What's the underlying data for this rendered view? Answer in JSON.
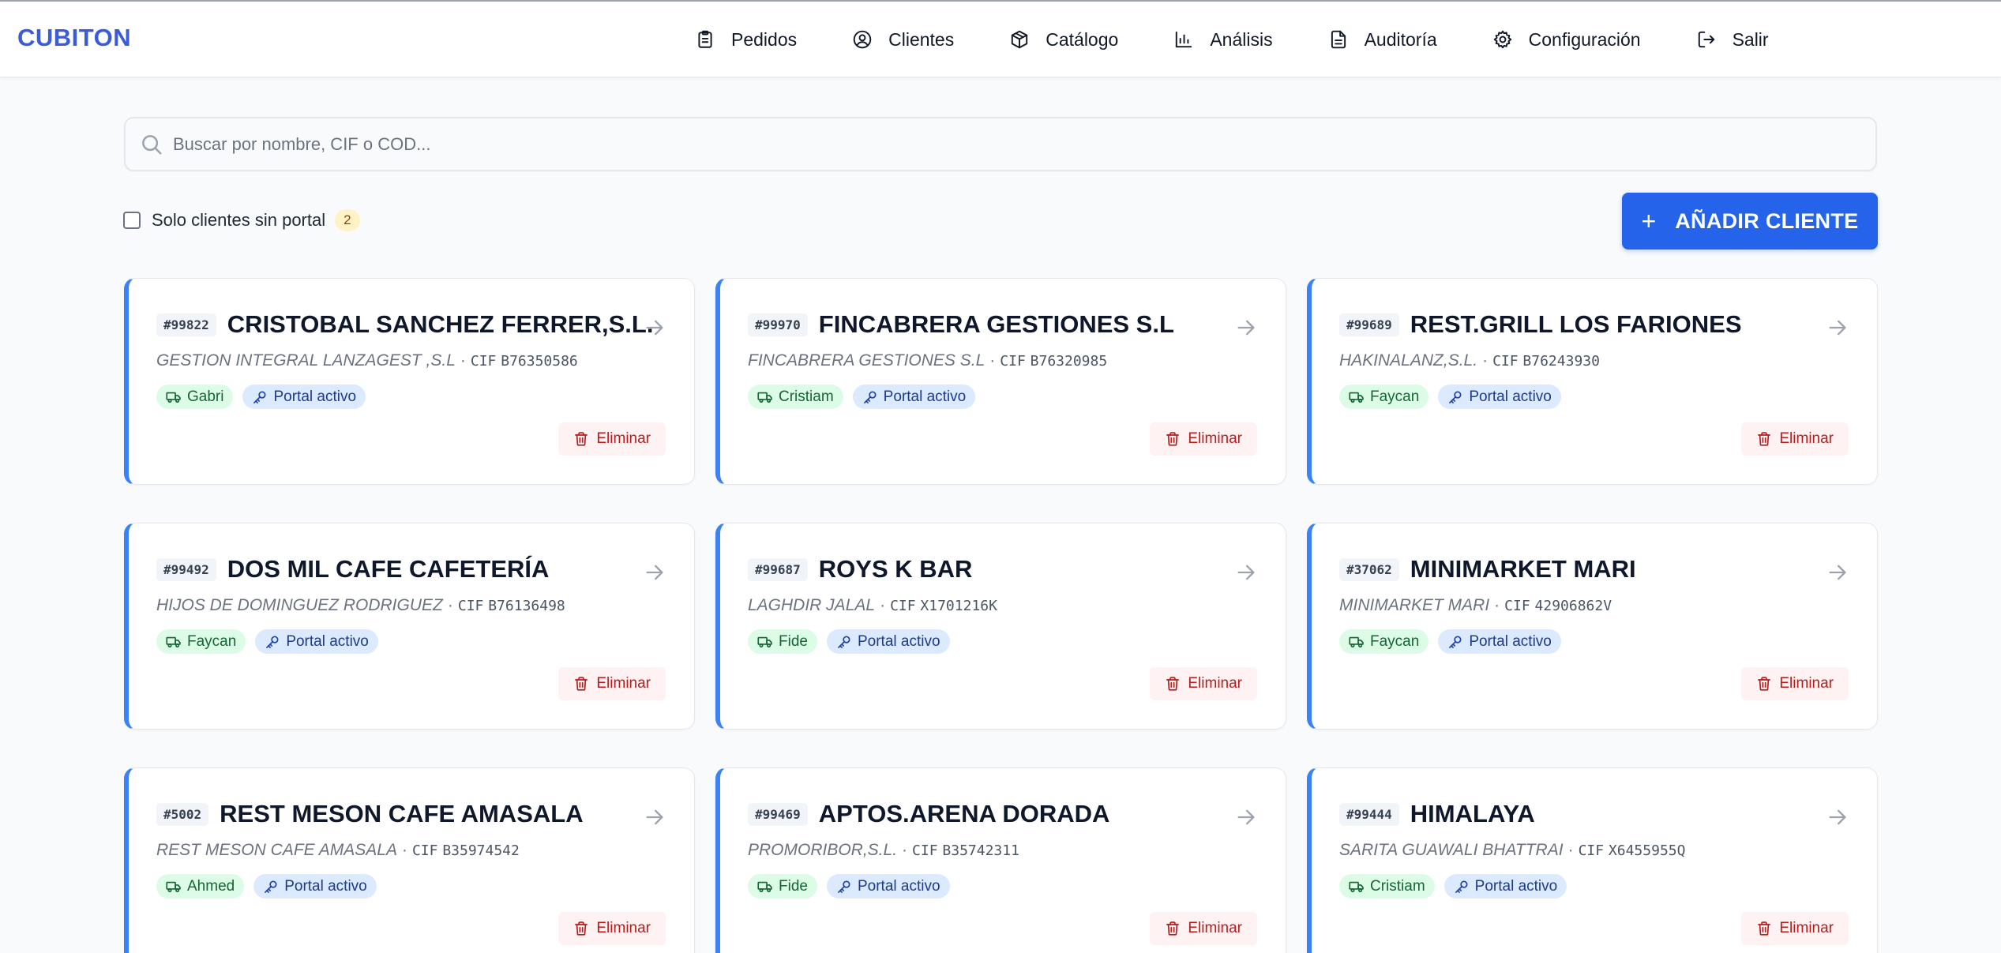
{
  "app": {
    "logo": "CUBITON"
  },
  "nav": [
    {
      "label": "Pedidos",
      "icon": "clipboard-icon"
    },
    {
      "label": "Clientes",
      "icon": "user-circle-icon"
    },
    {
      "label": "Catálogo",
      "icon": "box-icon"
    },
    {
      "label": "Análisis",
      "icon": "bar-chart-icon"
    },
    {
      "label": "Auditoría",
      "icon": "document-icon"
    },
    {
      "label": "Configuración",
      "icon": "gear-icon"
    },
    {
      "label": "Salir",
      "icon": "logout-icon"
    }
  ],
  "search": {
    "placeholder": "Buscar por nombre, CIF o COD...",
    "value": ""
  },
  "filter": {
    "label": "Solo clientes sin portal",
    "count": "2",
    "checked": false
  },
  "add_button": {
    "icon": "+",
    "label": "AÑADIR CLIENTE"
  },
  "colors": {
    "accent": "#2563eb",
    "brand": "#3b5bdb",
    "card_border": "#3b82f6",
    "delete": "#b91c1c"
  },
  "clients": [
    {
      "code": "#99822",
      "name": "CRISTOBAL SANCHEZ FERRER,S.L.",
      "company": "GESTION INTEGRAL LANZAGEST ,S.L",
      "cif_label": "CIF",
      "cif": "B76350586",
      "driver": "Gabri",
      "portal": "Portal activo",
      "delete_label": "Eliminar"
    },
    {
      "code": "#99970",
      "name": "FINCABRERA GESTIONES S.L",
      "company": "FINCABRERA GESTIONES S.L",
      "cif_label": "CIF",
      "cif": "B76320985",
      "driver": "Cristiam",
      "portal": "Portal activo",
      "delete_label": "Eliminar"
    },
    {
      "code": "#99689",
      "name": "REST.GRILL LOS FARIONES",
      "company": "HAKINALANZ,S.L.",
      "cif_label": "CIF",
      "cif": "B76243930",
      "driver": "Faycan",
      "portal": "Portal activo",
      "delete_label": "Eliminar"
    },
    {
      "code": "#99492",
      "name": "DOS MIL CAFE CAFETERÍA",
      "company": "HIJOS DE DOMINGUEZ RODRIGUEZ",
      "cif_label": "CIF",
      "cif": "B76136498",
      "driver": "Faycan",
      "portal": "Portal activo",
      "delete_label": "Eliminar"
    },
    {
      "code": "#99687",
      "name": "ROYS K BAR",
      "company": "LAGHDIR JALAL",
      "cif_label": "CIF",
      "cif": "X1701216K",
      "driver": "Fide",
      "portal": "Portal activo",
      "delete_label": "Eliminar"
    },
    {
      "code": "#37062",
      "name": "MINIMARKET MARI",
      "company": "MINIMARKET MARI",
      "cif_label": "CIF",
      "cif": "42906862V",
      "driver": "Faycan",
      "portal": "Portal activo",
      "delete_label": "Eliminar"
    },
    {
      "code": "#5002",
      "name": "REST MESON CAFE AMASALA",
      "company": "REST MESON CAFE AMASALA",
      "cif_label": "CIF",
      "cif": "B35974542",
      "driver": "Ahmed",
      "portal": "Portal activo",
      "delete_label": "Eliminar"
    },
    {
      "code": "#99469",
      "name": "APTOS.ARENA DORADA",
      "company": "PROMORIBOR,S.L.",
      "cif_label": "CIF",
      "cif": "B35742311",
      "driver": "Fide",
      "portal": "Portal activo",
      "delete_label": "Eliminar"
    },
    {
      "code": "#99444",
      "name": "HIMALAYA",
      "company": "SARITA GUAWALI BHATTRAI",
      "cif_label": "CIF",
      "cif": "X6455955Q",
      "driver": "Cristiam",
      "portal": "Portal activo",
      "delete_label": "Eliminar"
    }
  ]
}
